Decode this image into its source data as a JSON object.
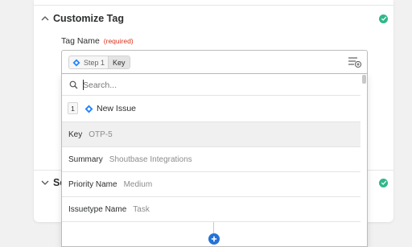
{
  "section1": {
    "title": "Customize Tag",
    "status": "complete",
    "status_color": "#30b78a"
  },
  "section2": {
    "title_visible": "Se",
    "status": "complete"
  },
  "field": {
    "label": "Tag Name",
    "required_label": "(required)",
    "required_color": "#d9321e"
  },
  "token": {
    "step": "Step 1",
    "key": "Key",
    "icon": "jira-icon"
  },
  "search": {
    "placeholder": "Search...",
    "value": ""
  },
  "step_group": {
    "number": "1",
    "name": "New Issue",
    "icon": "jira-icon"
  },
  "options": [
    {
      "key": "Key",
      "value": "OTP-5",
      "selected": true
    },
    {
      "key": "Summary",
      "value": "Shoutbase Integrations",
      "selected": false
    },
    {
      "key": "Priority Name",
      "value": "Medium",
      "selected": false
    },
    {
      "key": "Issuetype Name",
      "value": "Task",
      "selected": false
    }
  ],
  "colors": {
    "accent": "#2473d6",
    "jira_blue": "#2684ff",
    "check_green": "#30b78a"
  },
  "add_step_icon": "plus-icon"
}
